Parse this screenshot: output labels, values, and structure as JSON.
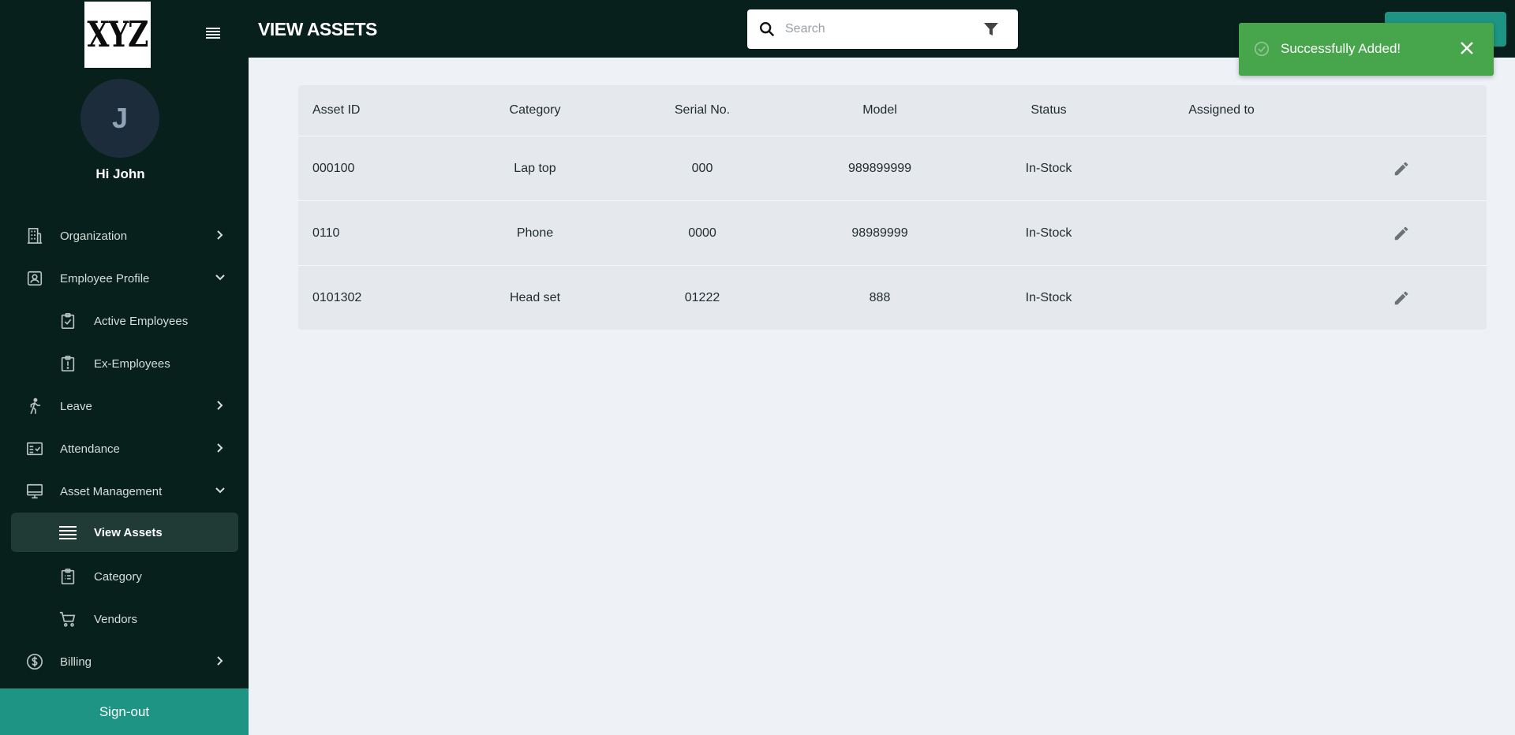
{
  "sidebar": {
    "logo_text": "XYZ",
    "avatar_initial": "J",
    "greeting": "Hi John",
    "items": [
      {
        "label": "Organization"
      },
      {
        "label": "Employee Profile"
      },
      {
        "label": "Active Employees"
      },
      {
        "label": "Ex-Employees"
      },
      {
        "label": "Leave"
      },
      {
        "label": "Attendance"
      },
      {
        "label": "Asset Management"
      },
      {
        "label": "View Assets"
      },
      {
        "label": "Category"
      },
      {
        "label": "Vendors"
      },
      {
        "label": "Billing"
      }
    ],
    "signout_label": "Sign-out"
  },
  "header": {
    "title": "VIEW ASSETS",
    "search_placeholder": "Search"
  },
  "toast": {
    "message": "Successfully Added!"
  },
  "table": {
    "columns": [
      "Asset ID",
      "Category",
      "Serial No.",
      "Model",
      "Status",
      "Assigned to"
    ],
    "rows": [
      {
        "asset_id": "000100",
        "category": "Lap top",
        "serial": "000",
        "model": "989899999",
        "status": "In-Stock",
        "assigned": ""
      },
      {
        "asset_id": "0110",
        "category": "Phone",
        "serial": "0000",
        "model": "98989999",
        "status": "In-Stock",
        "assigned": ""
      },
      {
        "asset_id": "0101302",
        "category": "Head set",
        "serial": "01222",
        "model": "888",
        "status": "In-Stock",
        "assigned": ""
      }
    ]
  },
  "colors": {
    "sidebar_bg": "#08201c",
    "accent": "#1e9484",
    "toast_bg": "#47a54b",
    "page_bg": "#eef2f7",
    "table_bg": "#e5e9ee"
  }
}
